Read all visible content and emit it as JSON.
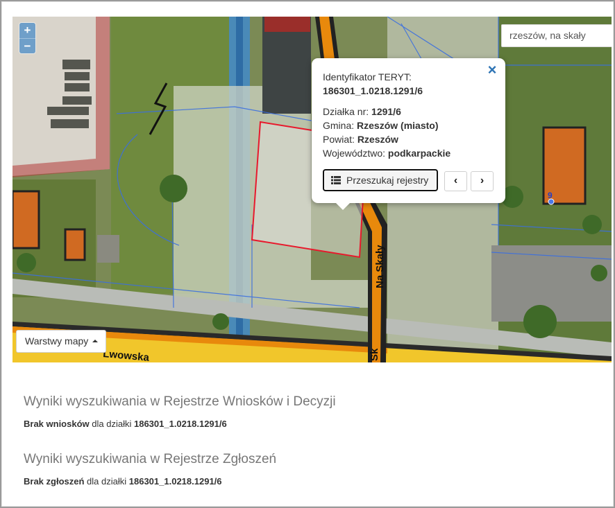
{
  "map": {
    "zoom_in": "+",
    "zoom_out": "−",
    "search_value": "rzeszów, na skały",
    "layers_label": "Warstwy mapy",
    "street_labels": {
      "na_skaly": "Na Skały",
      "lwowska": "Lwowska",
      "sk": "Sk"
    },
    "parcel_marker": "9"
  },
  "popup": {
    "teryt_label": "Identyfikator TERYT:",
    "teryt_value": "186301_1.0218.1291/6",
    "dzialka_label": "Działka nr:",
    "dzialka_value": "1291/6",
    "gmina_label": "Gmina:",
    "gmina_value": "Rzeszów (miasto)",
    "powiat_label": "Powiat:",
    "powiat_value": "Rzeszów",
    "woj_label": "Województwo:",
    "woj_value": "podkarpackie",
    "search_button": "Przeszukaj rejestry",
    "prev": "‹",
    "next": "›",
    "close": "×"
  },
  "results": [
    {
      "title": "Wyniki wyszukiwania w Rejestrze Wniosków i Decyzji",
      "bold": "Brak wniosków",
      "mid": "dla działki",
      "id": "186301_1.0218.1291/6"
    },
    {
      "title": "Wyniki wyszukiwania w Rejestrze Zgłoszeń",
      "bold": "Brak zgłoszeń",
      "mid": "dla działki",
      "id": "186301_1.0218.1291/6"
    }
  ],
  "colors": {
    "parcel_outline": "#e8192c",
    "road_orange": "#e8890c",
    "road_yellow": "#f1c62b",
    "cadastral_blue": "#3b6fe0",
    "zoom_button": "#6f9fc9"
  }
}
